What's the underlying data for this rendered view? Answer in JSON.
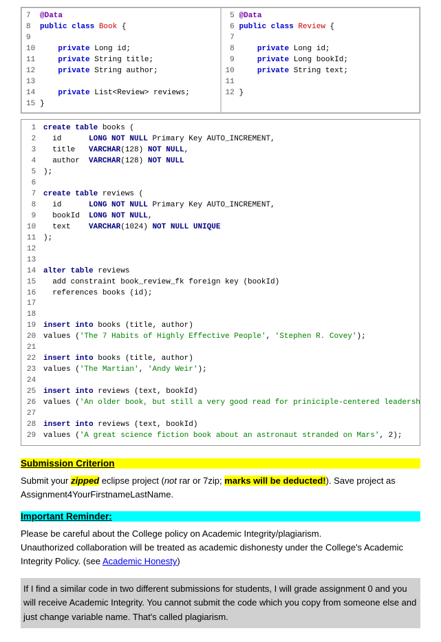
{
  "code_panels": {
    "left": {
      "lines": [
        {
          "num": 7,
          "content": "@Data"
        },
        {
          "num": 8,
          "content": "public class Book {"
        },
        {
          "num": 9,
          "content": ""
        },
        {
          "num": 10,
          "content": "    private Long id;"
        },
        {
          "num": 11,
          "content": "    private String title;"
        },
        {
          "num": 12,
          "content": "    private String author;"
        },
        {
          "num": 13,
          "content": ""
        },
        {
          "num": 14,
          "content": "    private List<Review> reviews;"
        },
        {
          "num": 15,
          "content": "}"
        }
      ]
    },
    "right": {
      "lines": [
        {
          "num": 5,
          "content": "@Data"
        },
        {
          "num": 6,
          "content": "public class Review {"
        },
        {
          "num": 7,
          "content": ""
        },
        {
          "num": 8,
          "content": "    private Long id;"
        },
        {
          "num": 9,
          "content": "    private Long bookId;"
        },
        {
          "num": 10,
          "content": "    private String text;"
        },
        {
          "num": 11,
          "content": ""
        },
        {
          "num": 12,
          "content": "}"
        }
      ]
    }
  },
  "submission": {
    "title": "Submission Criterion",
    "text1": "Submit your ",
    "zipped": "zipped",
    "text2": " eclipse project (",
    "not": "not",
    "text3": " rar or 7zip; ",
    "marks": "marks will be deducted!",
    "text4": ").  Save project as Assignment4YourFirstnameLastName."
  },
  "reminder": {
    "title": "Important Reminder:",
    "para1": "Please be careful about the College policy on Academic Integrity/plagiarism.\nUnauthorized collaboration will be treated as academic dishonesty under the College's Academic Integrity Policy. (see ",
    "link": "Academic Honesty",
    "para1_end": ")",
    "para2": "If I find a similar code in two different submissions for students, I will grade assignment 0 and you will receive Academic Integrity. You cannot submit the code which you copy from someone else and just change variable name. That's called plagiarism."
  }
}
